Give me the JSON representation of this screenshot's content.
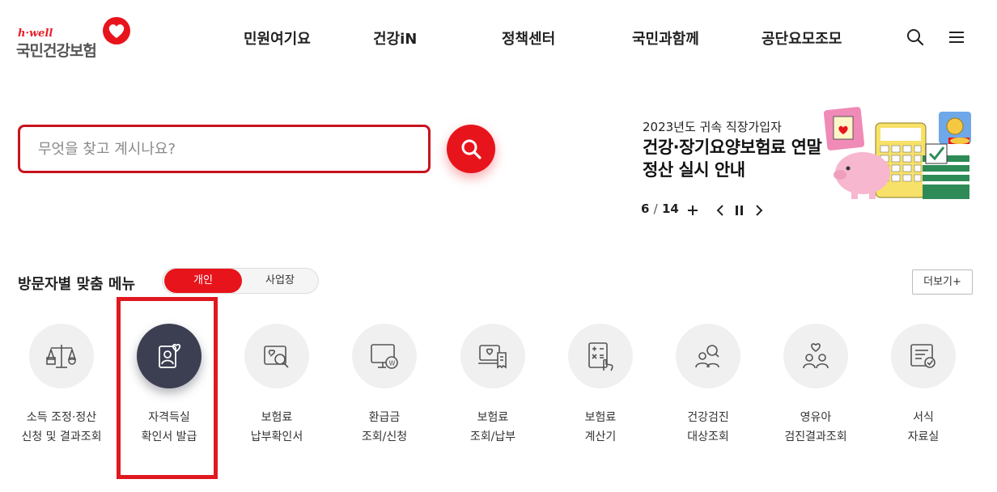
{
  "header": {
    "logo_sub": "h·well",
    "logo_main": "국민건강보험",
    "nav": [
      "민원여기요",
      "건강iN",
      "정책센터",
      "국민과함께",
      "공단요모조모"
    ]
  },
  "search": {
    "placeholder": "무엇을 찾고 계시나요?"
  },
  "banner": {
    "subtitle": "2023년도 귀속 직장가입자",
    "title": "건강·장기요양보험료 연말정산 실시 안내",
    "current": "6",
    "total": "14",
    "separator": "/"
  },
  "menu": {
    "title": "방문자별 맞춤 메뉴",
    "toggle_personal": "개인",
    "toggle_business": "사업장",
    "more": "더보기+",
    "items": [
      {
        "line1": "소득 조정·정산",
        "line2": "신청 및 결과조회",
        "icon": "scale-icon"
      },
      {
        "line1": "자격득실",
        "line2": "확인서 발급",
        "icon": "id-card-heart-icon"
      },
      {
        "line1": "보험료",
        "line2": "납부확인서",
        "icon": "document-search-icon"
      },
      {
        "line1": "환급금",
        "line2": "조회/신청",
        "icon": "monitor-won-icon"
      },
      {
        "line1": "보험료",
        "line2": "조회/납부",
        "icon": "laptop-receipt-icon"
      },
      {
        "line1": "보험료",
        "line2": "계산기",
        "icon": "calculator-icon"
      },
      {
        "line1": "건강검진",
        "line2": "대상조회",
        "icon": "people-search-icon"
      },
      {
        "line1": "영유아",
        "line2": "검진결과조회",
        "icon": "family-heart-icon"
      },
      {
        "line1": "서식",
        "line2": "자료실",
        "icon": "form-check-icon"
      }
    ]
  },
  "colors": {
    "brand_red": "#e8141c",
    "active_icon_bg": "#3c3f52",
    "icon_bg": "#f0f0f0"
  }
}
